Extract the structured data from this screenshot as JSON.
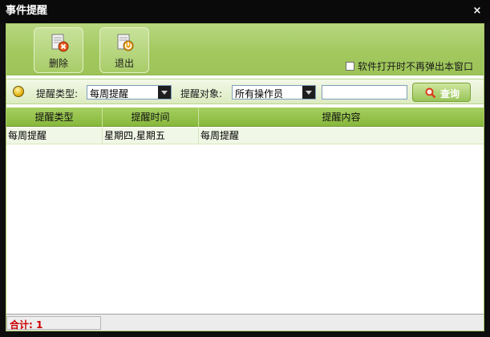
{
  "window": {
    "title": "事件提醒",
    "close_glyph": "×"
  },
  "toolbar": {
    "delete_label": "删除",
    "exit_label": "退出",
    "no_popup_label": "软件打开时不再弹出本窗口",
    "no_popup_checked": false
  },
  "filter": {
    "type_label": "提醒类型:",
    "type_value": "每周提醒",
    "target_label": "提醒对象:",
    "target_value": "所有操作员",
    "search_value": "",
    "query_label": "查询"
  },
  "grid": {
    "columns": [
      "提醒类型",
      "提醒时间",
      "提醒内容"
    ],
    "rows": [
      {
        "type": "每周提醒",
        "time": "星期四,星期五",
        "content": "每周提醒"
      }
    ]
  },
  "footer": {
    "total": "合计: 1"
  },
  "colors": {
    "accent": "#a2c85f",
    "header": "#87b83c",
    "total_text": "#cc0000"
  },
  "icons": [
    "delete-icon",
    "exit-icon",
    "bulb-icon",
    "search-icon",
    "close-icon"
  ]
}
